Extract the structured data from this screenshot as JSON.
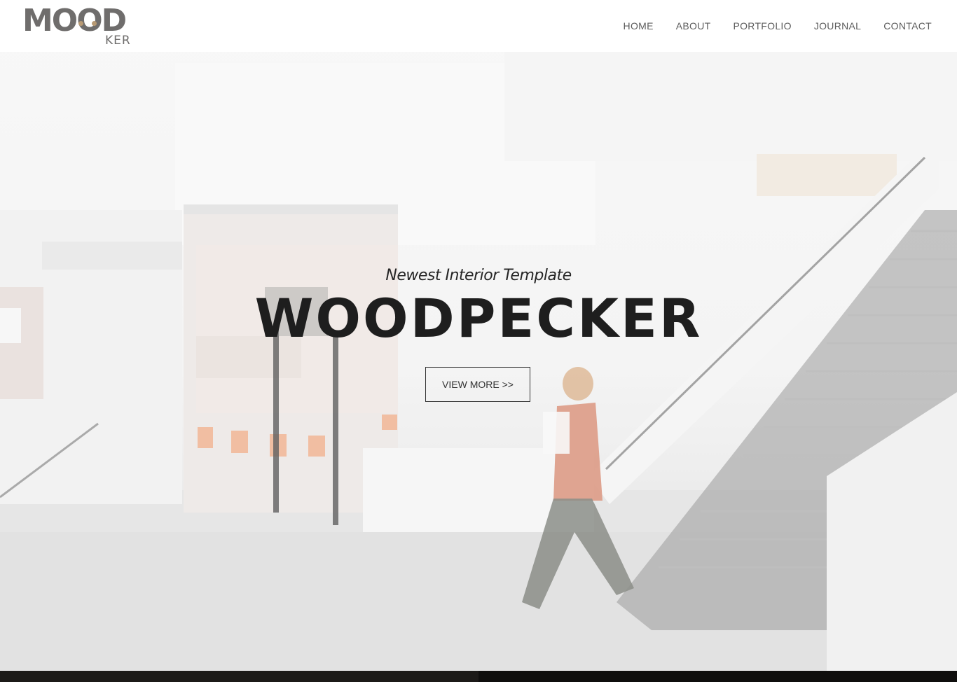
{
  "header": {
    "logo": {
      "main": "MOOD",
      "sub": "KER"
    },
    "nav": {
      "home": "HOME",
      "about": "ABOUT",
      "portfolio": "PORTFOLIO",
      "journal": "JOURNAL",
      "contact": "CONTACT"
    }
  },
  "hero": {
    "tagline": "Newest Interior Template",
    "title": "WOODPECKER",
    "button_label": "VIEW MORE >>"
  },
  "colors": {
    "text_dark": "#1e1e1e",
    "nav_text": "#5d5d5d",
    "logo_gray": "#6f6d6c",
    "logo_accent": "#b89a74",
    "footer_strip": "#1c1a18"
  }
}
